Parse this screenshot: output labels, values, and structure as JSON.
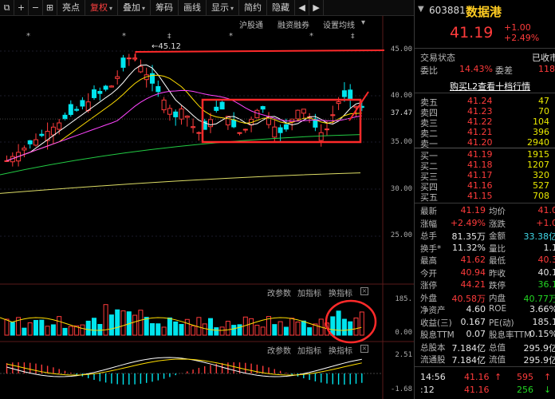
{
  "toolbar": {
    "items": [
      {
        "label": "亮点"
      },
      {
        "label": "复权"
      },
      {
        "label": "叠加"
      },
      {
        "label": "筹码"
      },
      {
        "label": "画线"
      },
      {
        "label": "显示"
      },
      {
        "label": "简约"
      },
      {
        "label": "隐藏"
      }
    ]
  },
  "chart": {
    "top_links": [
      "沪股通",
      "融资融券",
      "设置均线"
    ],
    "high_annotation": "45.12",
    "price_axis": [
      "45.00",
      "40.00",
      "37.47",
      "35.00",
      "30.00",
      "25.00"
    ],
    "vol_panel": {
      "buttons": [
        "改参数",
        "加指标",
        "换指标"
      ],
      "axis": [
        "185.",
        "0.00"
      ]
    },
    "macd_panel": {
      "buttons": [
        "改参数",
        "加指标",
        "换指标"
      ],
      "axis": [
        "2.51",
        "-1.68"
      ]
    },
    "close_symbol": "×"
  },
  "quote": {
    "code": "603881",
    "name": "数据港",
    "price": "41.19",
    "change": "+1.00",
    "change_pct": "+2.49%",
    "status_label": "交易状态",
    "status_value": "已收市",
    "weibi_label": "委比",
    "weibi_value": "14.43%",
    "weicha_label": "委差",
    "weicha_value": "118",
    "l2_link": "购买L2查看十档行情",
    "asks": [
      {
        "label": "卖五",
        "price": "41.24",
        "vol": "47"
      },
      {
        "label": "卖四",
        "price": "41.23",
        "vol": "70"
      },
      {
        "label": "卖三",
        "price": "41.22",
        "vol": "104"
      },
      {
        "label": "卖二",
        "price": "41.21",
        "vol": "396"
      },
      {
        "label": "卖一",
        "price": "41.20",
        "vol": "2940"
      }
    ],
    "bids": [
      {
        "label": "买一",
        "price": "41.19",
        "vol": "1915"
      },
      {
        "label": "买二",
        "price": "41.18",
        "vol": "1207"
      },
      {
        "label": "买三",
        "price": "41.17",
        "vol": "320"
      },
      {
        "label": "买四",
        "price": "41.16",
        "vol": "527"
      },
      {
        "label": "买五",
        "price": "41.15",
        "vol": "708"
      }
    ],
    "stats": [
      {
        "l1": "最新",
        "v1": "41.19",
        "c1": "red",
        "l2": "均价",
        "v2": "41.0",
        "c2": "red"
      },
      {
        "l1": "涨幅",
        "v1": "+2.49%",
        "c1": "red",
        "l2": "涨跌",
        "v2": "+1.0",
        "c2": "red"
      },
      {
        "l1": "总手",
        "v1": "81.35万",
        "c1": "white",
        "l2": "金额",
        "v2": "33.38亿",
        "c2": "cyan"
      },
      {
        "l1": "换手*",
        "v1": "11.32%",
        "c1": "white",
        "l2": "量比",
        "v2": "1.1",
        "c2": "white"
      },
      {
        "l1": "最高",
        "v1": "41.62",
        "c1": "red",
        "l2": "最低",
        "v2": "40.3",
        "c2": "red"
      },
      {
        "l1": "今开",
        "v1": "40.94",
        "c1": "red",
        "l2": "昨收",
        "v2": "40.1",
        "c2": "white"
      },
      {
        "l1": "涨停",
        "v1": "44.21",
        "c1": "red",
        "l2": "跌停",
        "v2": "36.1",
        "c2": "green"
      },
      {
        "l1": "外盘",
        "v1": "40.58万",
        "c1": "red",
        "l2": "内盘",
        "v2": "40.77万",
        "c2": "green"
      },
      {
        "l1": "净资产",
        "v1": "4.60",
        "c1": "white",
        "l2": "ROE",
        "v2": "3.66%",
        "c2": "white"
      },
      {
        "l1": "收益(三)",
        "v1": "0.167",
        "c1": "white",
        "l2": "PE(动)",
        "v2": "185.1",
        "c2": "white"
      },
      {
        "l1": "股息TTM",
        "v1": "0.07",
        "c1": "white",
        "l2": "股息率TTM",
        "v2": "0.15%",
        "c2": "white"
      },
      {
        "l1": "总股本",
        "v1": "7.184亿",
        "c1": "white",
        "l2": "总值",
        "v2": "295.9亿",
        "c2": "white"
      },
      {
        "l1": "流通股",
        "v1": "7.184亿",
        "c1": "white",
        "l2": "流值",
        "v2": "295.9亿",
        "c2": "white"
      }
    ],
    "ticks": [
      {
        "time": "14:56",
        "price": "41.16",
        "arrow": "↑",
        "vol": "595",
        "flag": "↑"
      },
      {
        "time": ":12",
        "price": "41.16",
        "arrow": "",
        "vol": "256",
        "flag": "↓"
      }
    ]
  },
  "colors": {
    "up": "#ff3b3b",
    "down": "#22d622",
    "cyan_candle": "#00e5ee",
    "box": "#ff2a2a"
  }
}
